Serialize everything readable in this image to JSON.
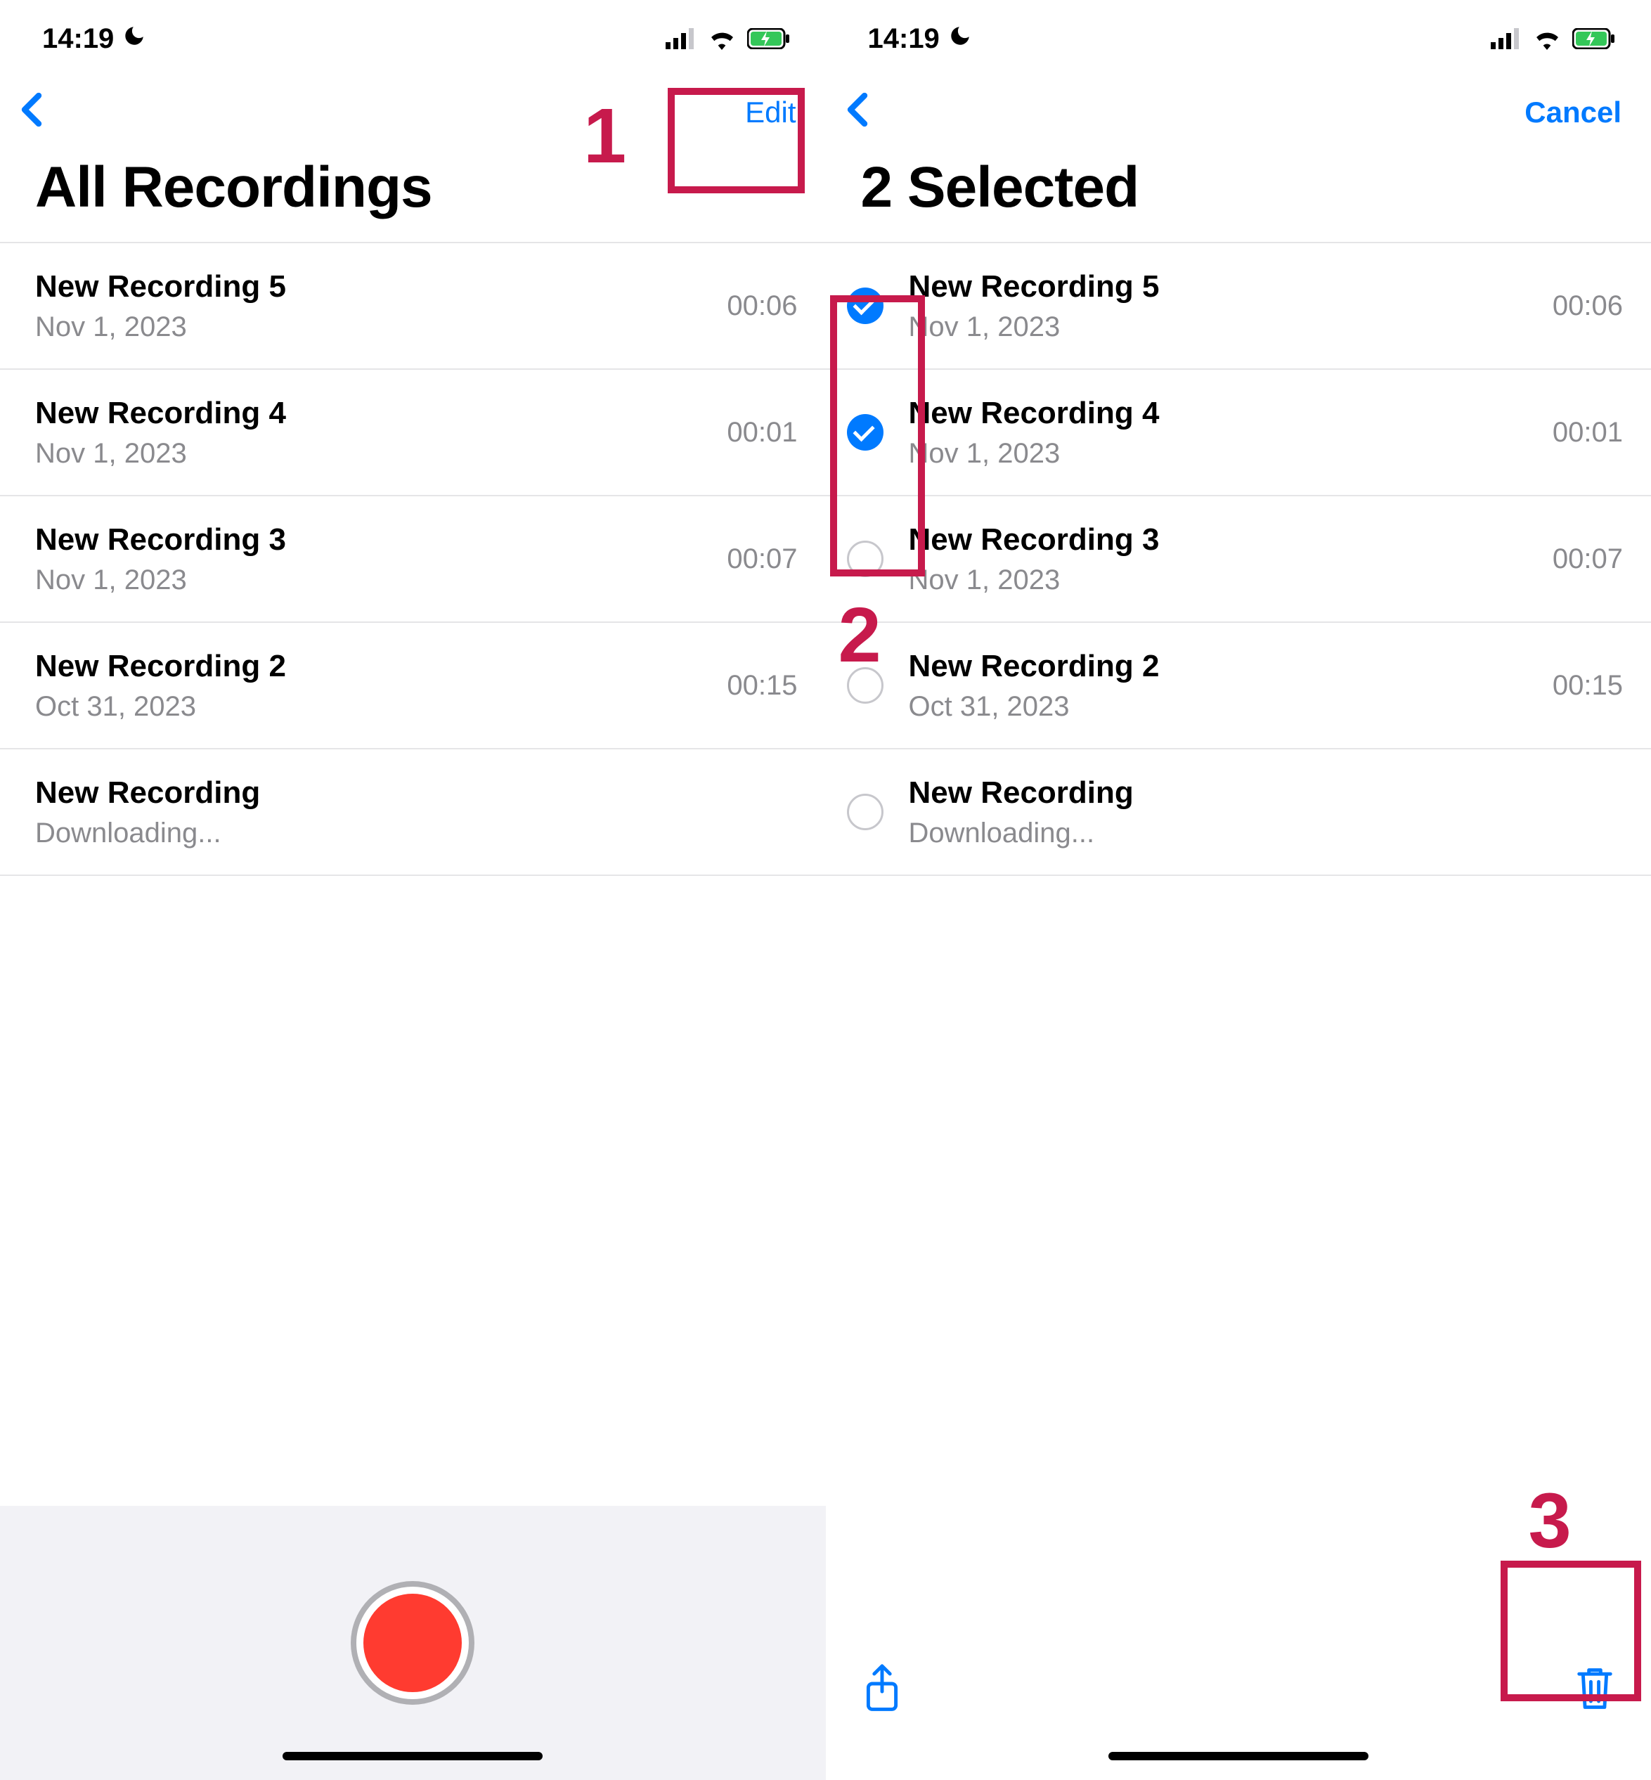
{
  "status": {
    "time": "14:19"
  },
  "left": {
    "nav_right": "Edit",
    "title": "All Recordings",
    "rows": [
      {
        "title": "New Recording 5",
        "sub": "Nov 1, 2023",
        "dur": "00:06"
      },
      {
        "title": "New Recording 4",
        "sub": "Nov 1, 2023",
        "dur": "00:01"
      },
      {
        "title": "New Recording 3",
        "sub": "Nov 1, 2023",
        "dur": "00:07"
      },
      {
        "title": "New Recording 2",
        "sub": "Oct 31, 2023",
        "dur": "00:15"
      },
      {
        "title": "New Recording",
        "sub": "Downloading...",
        "dur": ""
      }
    ]
  },
  "right": {
    "nav_right": "Cancel",
    "title": "2 Selected",
    "rows": [
      {
        "title": "New Recording 5",
        "sub": "Nov 1, 2023",
        "dur": "00:06",
        "checked": true
      },
      {
        "title": "New Recording 4",
        "sub": "Nov 1, 2023",
        "dur": "00:01",
        "checked": true
      },
      {
        "title": "New Recording 3",
        "sub": "Nov 1, 2023",
        "dur": "00:07",
        "checked": false
      },
      {
        "title": "New Recording 2",
        "sub": "Oct 31, 2023",
        "dur": "00:15",
        "checked": false
      },
      {
        "title": "New Recording",
        "sub": "Downloading...",
        "dur": "",
        "checked": false
      }
    ]
  },
  "annotations": {
    "n1": "1",
    "n2": "2",
    "n3": "3"
  }
}
